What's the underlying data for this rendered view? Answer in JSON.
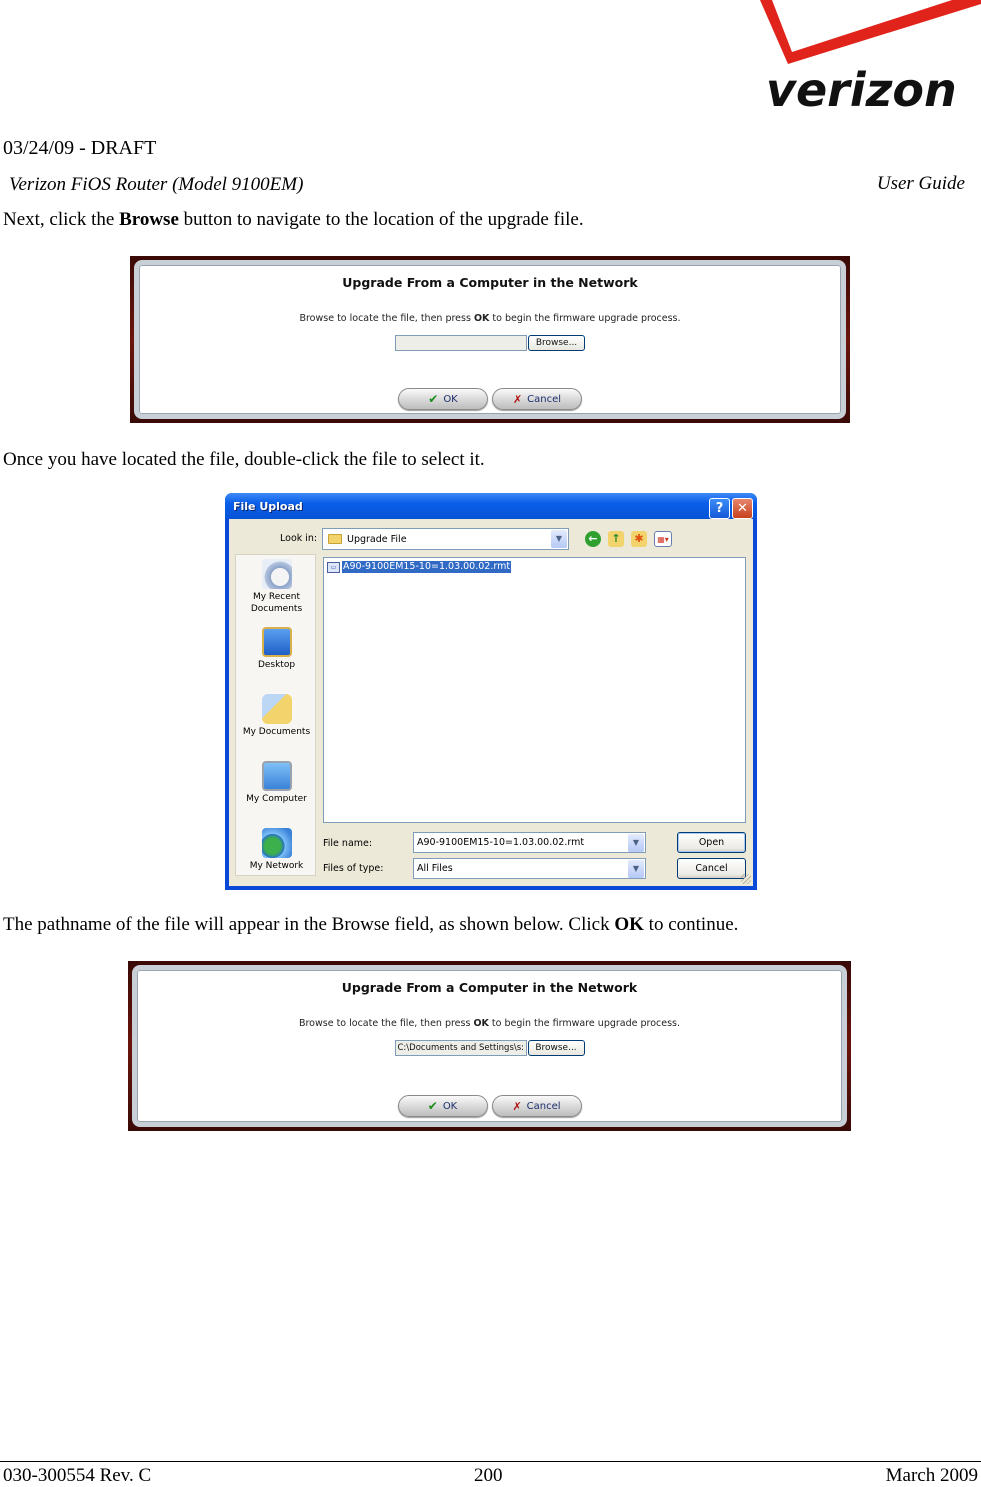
{
  "header": {
    "logo_text": "verizon",
    "draft_label": "03/24/09 - DRAFT",
    "model": "Verizon FiOS Router (Model 9100EM)",
    "doc_type": "User Guide"
  },
  "paragraphs": {
    "p1": {
      "before": "Next, click the ",
      "bold": "Browse",
      "after": " button to navigate to the location of the upgrade file."
    },
    "p2": {
      "text": "Once you have located the file, double-click the file to select it."
    },
    "p3": {
      "before": "The pathname of the file will appear in the Browse field, as shown below. Click ",
      "bold": "OK",
      "after": " to continue."
    }
  },
  "panel1": {
    "title": "Upgrade From a Computer in the Network",
    "desc_before": "Browse to locate the file, then press ",
    "desc_bold": "OK",
    "desc_after": " to begin the firmware upgrade process.",
    "file_value": "",
    "browse_label": "Browse...",
    "ok_label": "OK",
    "cancel_label": "Cancel"
  },
  "dialog": {
    "title": "File Upload",
    "help_label": "?",
    "close_label": "✕",
    "look_in_label": "Look in:",
    "look_in_value": "Upgrade File",
    "places": [
      "My Recent Documents",
      "Desktop",
      "My Documents",
      "My Computer",
      "My Network"
    ],
    "files": [
      {
        "name": "A90-9100EM15-10=1.03.00.02.rmt",
        "selected": true
      }
    ],
    "file_name_label": "File name:",
    "file_name_value": "A90-9100EM15-10=1.03.00.02.rmt",
    "files_of_type_label": "Files of type:",
    "files_of_type_value": "All Files",
    "open_label": "Open",
    "cancel_label": "Cancel"
  },
  "panel2": {
    "title": "Upgrade From a Computer in the Network",
    "desc_before": "Browse to locate the file, then press ",
    "desc_bold": "OK",
    "desc_after": " to begin the firmware upgrade process.",
    "file_value": "C:\\Documents and Settings\\s:",
    "browse_label": "Browse...",
    "ok_label": "OK",
    "cancel_label": "Cancel"
  },
  "footer": {
    "doc_number": "030-300554 Rev. C",
    "page_number": "200",
    "date": "March 2009"
  },
  "colors": {
    "verizon_red": "#e0241b",
    "xp_title_blue": "#0a5ee8",
    "selection_blue": "#316ac5"
  }
}
